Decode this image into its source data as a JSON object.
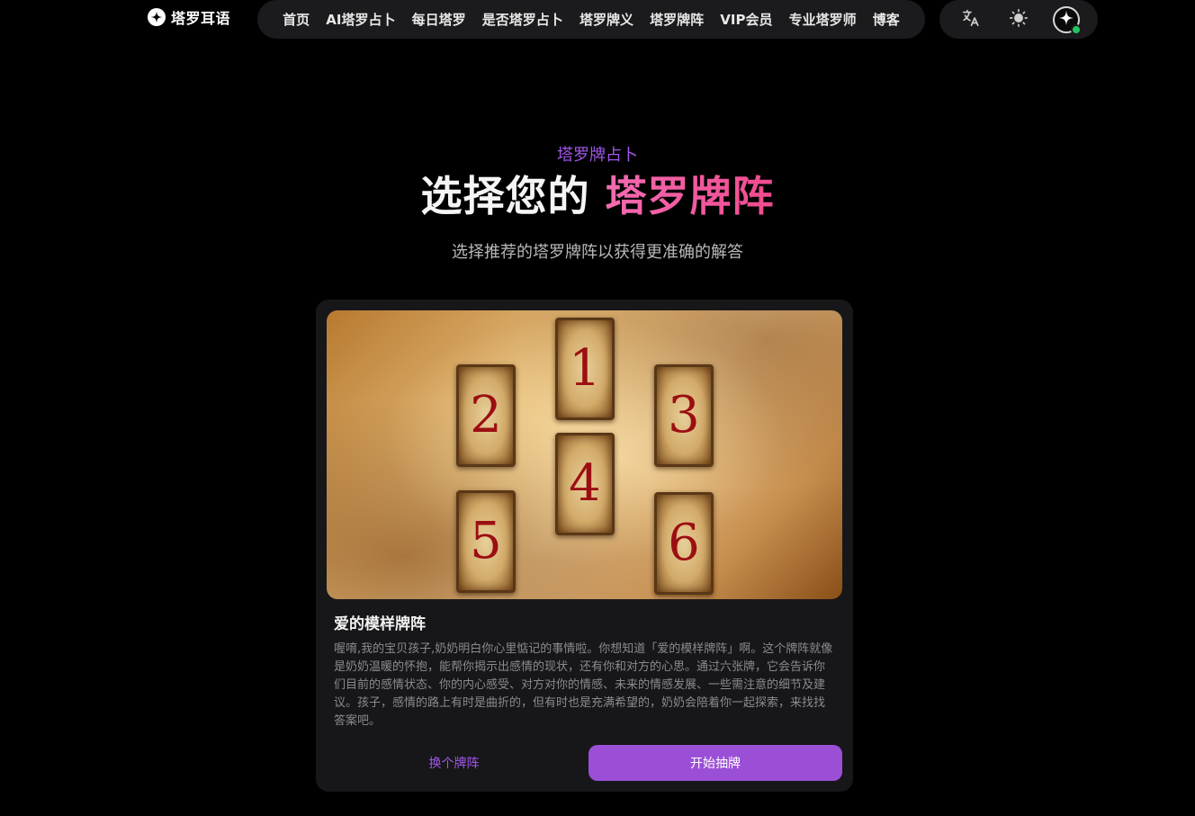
{
  "header": {
    "logo_text": "塔罗耳语",
    "nav": [
      "首页",
      "AI塔罗占卜",
      "每日塔罗",
      "是否塔罗占卜",
      "塔罗牌义",
      "塔罗牌阵",
      "VIP会员",
      "专业塔罗师",
      "博客"
    ],
    "icons": [
      "translate-icon",
      "sun-icon",
      "sparkle-avatar-icon"
    ]
  },
  "hero": {
    "eyebrow": "塔罗牌占卜",
    "title_main": "选择您的",
    "title_accent": "塔罗牌阵",
    "subtitle": "选择推荐的塔罗牌阵以获得更准确的解答"
  },
  "spread": {
    "cards": [
      "1",
      "2",
      "3",
      "4",
      "5",
      "6"
    ],
    "name": "爱的模样牌阵",
    "description": "喔唷,我的宝贝孩子,奶奶明白你心里惦记的事情啦。你想知道「爱的模样牌阵」啊。这个牌阵就像是奶奶温暖的怀抱，能帮你揭示出感情的现状，还有你和对方的心思。通过六张牌，它会告诉你们目前的感情状态、你的内心感受、对方对你的情感、未来的情感发展、一些需注意的细节及建议。孩子，感情的路上有时是曲折的，但有时也是充满希望的，奶奶会陪着你一起探索，来找找答案吧。",
    "switch_label": "换个牌阵",
    "start_label": "开始抽牌"
  },
  "colors": {
    "background": "#000000",
    "accent_purple": "#a257ea",
    "accent_pink": "#f04a8e",
    "button_purple": "#9b4fd6",
    "online_green": "#22c55e"
  }
}
